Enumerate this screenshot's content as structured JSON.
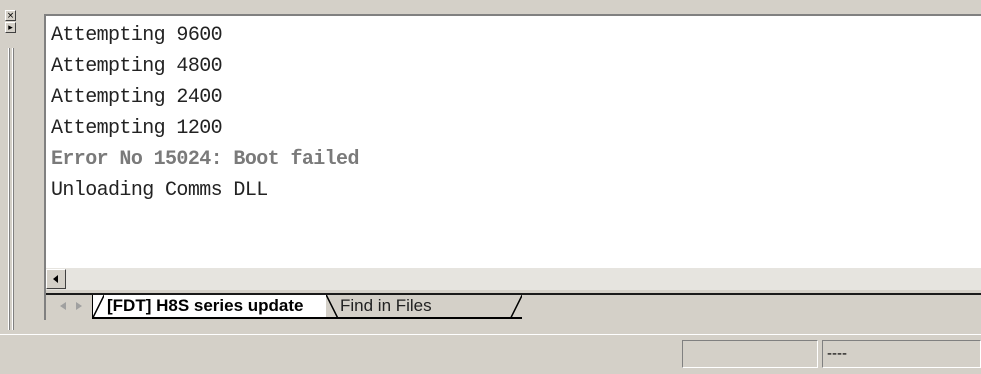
{
  "gripper": {
    "close_glyph": "×",
    "menu_glyph": "▸"
  },
  "output": {
    "lines": [
      {
        "text": "Attempting 9600",
        "kind": "normal"
      },
      {
        "text": "Attempting 4800",
        "kind": "normal"
      },
      {
        "text": "Attempting 2400",
        "kind": "normal"
      },
      {
        "text": "Attempting 1200",
        "kind": "normal"
      },
      {
        "text": "Error No 15024: Boot failed",
        "kind": "error"
      },
      {
        "text": "Unloading Comms DLL",
        "kind": "normal"
      }
    ]
  },
  "tabs": [
    {
      "label": "[FDT] H8S series update",
      "active": true
    },
    {
      "label": "Find in Files",
      "active": false
    }
  ],
  "statusbar": {
    "main_text": "",
    "mid_text": "",
    "right_text": "----"
  }
}
